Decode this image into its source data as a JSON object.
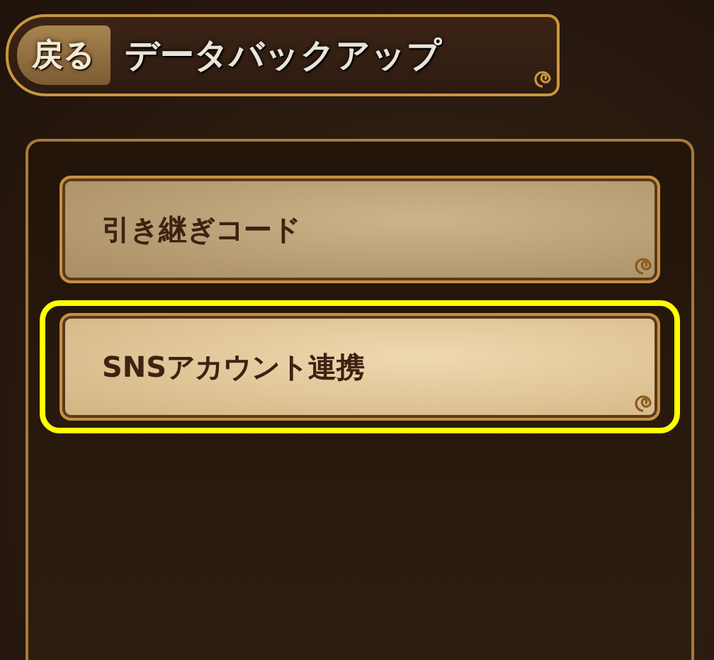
{
  "header": {
    "back_button": "戻る",
    "title": "データバックアップ"
  },
  "menu": [
    {
      "label": "引き継ぎコード",
      "selected": false
    },
    {
      "label": "SNSアカウント連携",
      "selected": true
    }
  ]
}
